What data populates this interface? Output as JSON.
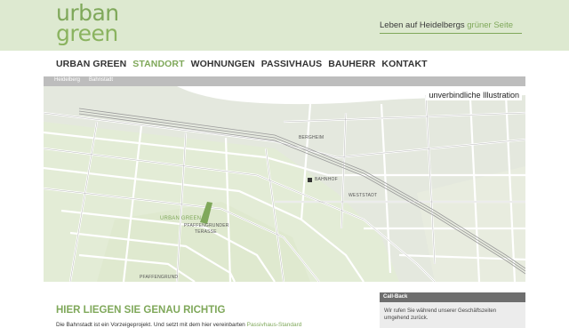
{
  "logo": {
    "line1": "urban",
    "line2": "green"
  },
  "tagline": {
    "text": "Leben auf Heidelbergs ",
    "accent": "grüner Seite"
  },
  "nav": [
    {
      "label": "URBAN GREEN",
      "active": false
    },
    {
      "label": "STANDORT",
      "active": true
    },
    {
      "label": "WOHNUNGEN",
      "active": false
    },
    {
      "label": "PASSIVHAUS",
      "active": false
    },
    {
      "label": "BAUHERR",
      "active": false
    },
    {
      "label": "KONTAKT",
      "active": false
    }
  ],
  "breadcrumb": [
    "Heidelberg",
    "Bahnstadt"
  ],
  "map": {
    "caption": "unverbindliche Illustration",
    "labels": {
      "site": "URBAN GREEN",
      "terrace_1": "PFAFFENGRUNDER",
      "terrace_2": "TERASSE",
      "station": "BAHNHOF",
      "street_1": "BERGHEIM",
      "street_2": "WESTSTADT",
      "street_3": "PFAFFENGRUND"
    }
  },
  "section": {
    "heading": "HIER LIEGEN SIE GENAU RICHTIG",
    "body": "Die Bahnstadt ist ein Vorzeigeprojekt. Und setzt mit dem hier vereinbarten ",
    "link": "Passivhaus-Standard"
  },
  "callback": {
    "title": "Call-Back",
    "text": "Wir rufen Sie während unserer Geschäftszeiten umgehend zurück."
  },
  "colors": {
    "accent": "#7fa85a",
    "header_bg": "#dde9d0",
    "crumb_bg": "#bdbdbd",
    "callback_head": "#6e6e6e"
  }
}
